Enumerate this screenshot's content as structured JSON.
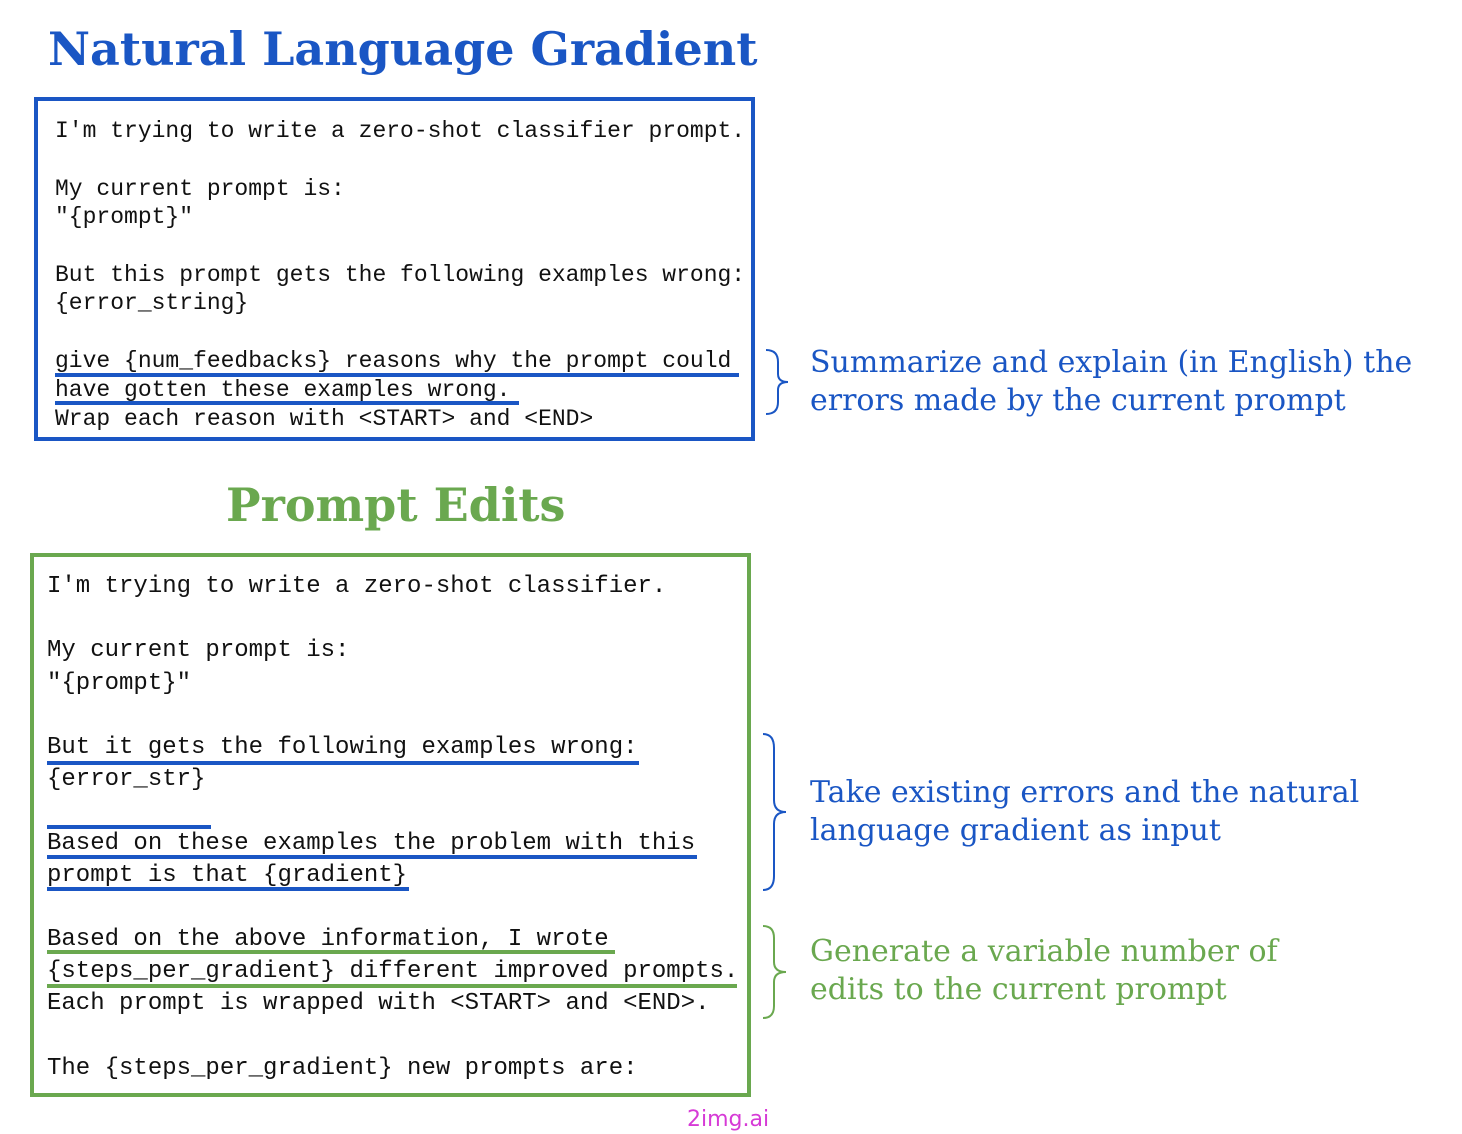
{
  "colors": {
    "blue": "#1a56c4",
    "green": "#6aa84f",
    "text": "#111111",
    "watermark": "#d63ad6"
  },
  "gradient": {
    "title": "Natural Language Gradient",
    "lines": [
      "I'm trying to write a zero-shot classifier prompt.",
      "My current prompt is:",
      "\"{prompt}\"",
      "But this prompt gets the following examples wrong:",
      "{error_string}",
      "give {num_feedbacks} reasons why the prompt could",
      "have gotten these examples wrong.",
      "Wrap each reason with <START> and <END>"
    ],
    "annotation": [
      "Summarize and explain (in English) the",
      "errors made by the current prompt"
    ]
  },
  "edits": {
    "title": "Prompt Edits",
    "lines": [
      "I'm trying to write a zero-shot classifier.",
      "My current prompt is:",
      "\"{prompt}\"",
      "But it gets the following examples wrong:",
      "{error_str}",
      "Based on these examples the problem with this",
      "prompt is that {gradient}",
      "Based on the above information, I wrote",
      "{steps_per_gradient} different improved prompts.",
      "Each prompt is wrapped with <START> and <END>.",
      "The {steps_per_gradient} new prompts are:"
    ],
    "annotation_inputs": [
      "Take existing errors and the natural",
      "language gradient as input"
    ],
    "annotation_edits": [
      "Generate a variable number of",
      "edits to the current prompt"
    ]
  },
  "watermark": "2img.ai"
}
